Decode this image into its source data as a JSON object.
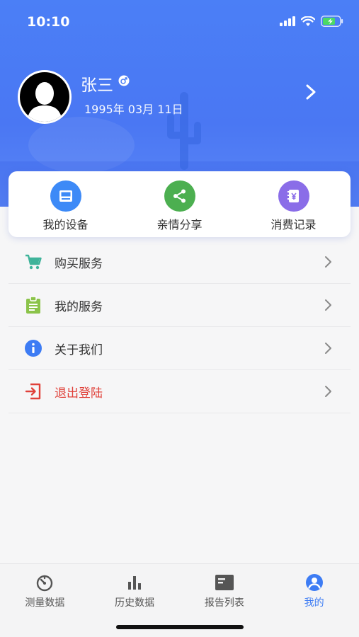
{
  "status_bar": {
    "time": "10:10"
  },
  "profile": {
    "name": "张三",
    "birth": "1995年 03月 11日"
  },
  "quick_actions": [
    {
      "label": "我的设备",
      "icon": "device-icon",
      "color": "#3d8af7"
    },
    {
      "label": "亲情分享",
      "icon": "share-icon",
      "color": "#4caf50"
    },
    {
      "label": "消费记录",
      "icon": "receipt-icon",
      "color": "#8a6de8"
    }
  ],
  "menu": [
    {
      "label": "购买服务",
      "icon": "cart-icon",
      "color": "#3fb39a"
    },
    {
      "label": "我的服务",
      "icon": "clipboard-icon",
      "color": "#8bc34a"
    },
    {
      "label": "关于我们",
      "icon": "info-icon",
      "color": "#3d7cf4"
    },
    {
      "label": "退出登陆",
      "icon": "logout-icon",
      "color": "#e0413a"
    }
  ],
  "tabs": [
    {
      "label": "测量数据",
      "icon": "gauge-icon",
      "active": false
    },
    {
      "label": "历史数据",
      "icon": "bar-chart-icon",
      "active": false
    },
    {
      "label": "报告列表",
      "icon": "report-icon",
      "active": false
    },
    {
      "label": "我的",
      "icon": "user-icon",
      "active": true
    }
  ],
  "colors": {
    "accent": "#3d7cf4",
    "header": "#4b7ff6",
    "danger": "#e0413a"
  }
}
